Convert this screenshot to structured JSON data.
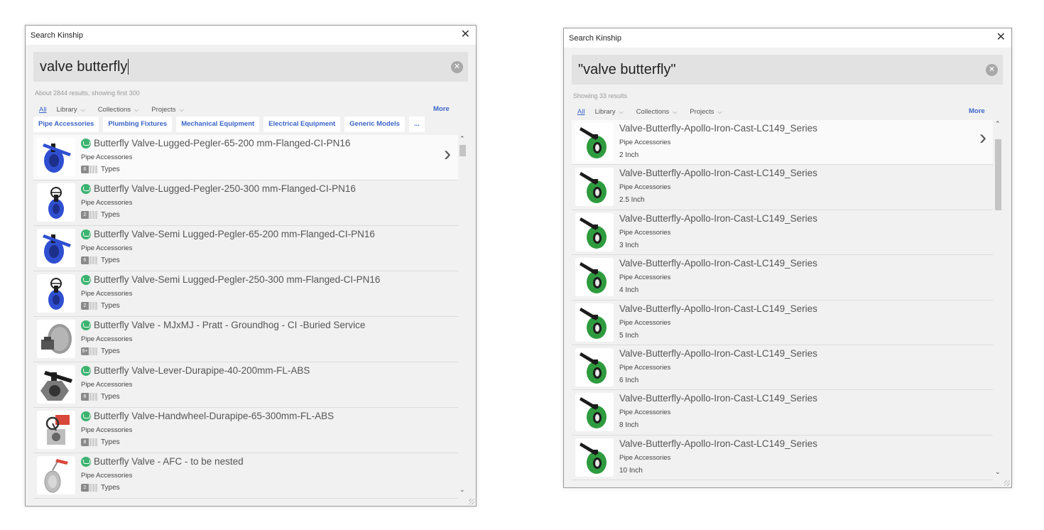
{
  "left_window": {
    "title": "Search Kinship",
    "query": "valve butterfly",
    "result_count": "About 2844 results, showing first 300",
    "tabs": [
      {
        "label": "All"
      },
      {
        "label": "Library"
      },
      {
        "label": "Collections"
      },
      {
        "label": "Projects"
      }
    ],
    "more_label": "More",
    "chips": [
      "Pipe Accessories",
      "Plumbing Fixtures",
      "Mechanical Equipment",
      "Electrical Equipment",
      "Generic Models",
      "..."
    ],
    "results": [
      {
        "title": "Butterfly Valve-Lugged-Pegler-65-200 mm-Flanged-CI-PN16",
        "category": "Pipe Accessories",
        "type_count": "6",
        "types_label": "Types",
        "thumb": "blue-lever-valve"
      },
      {
        "title": "Butterfly Valve-Lugged-Pegler-250-300 mm-Flanged-CI-PN16",
        "category": "Pipe Accessories",
        "type_count": "2",
        "types_label": "Types",
        "thumb": "blue-wheel-valve"
      },
      {
        "title": "Butterfly Valve-Semi Lugged-Pegler-65-200 mm-Flanged-CI-PN16",
        "category": "Pipe Accessories",
        "type_count": "6",
        "types_label": "Types",
        "thumb": "blue-lever-valve"
      },
      {
        "title": "Butterfly Valve-Semi Lugged-Pegler-250-300 mm-Flanged-CI-PN16",
        "category": "Pipe Accessories",
        "type_count": "2",
        "types_label": "Types",
        "thumb": "blue-wheel-valve"
      },
      {
        "title": "Butterfly Valve - MJxMJ - Pratt - Groundhog - CI -Buried Service",
        "category": "Pipe Accessories",
        "type_count": "9+",
        "types_label": "Types",
        "thumb": "grey-buried-valve"
      },
      {
        "title": "Butterfly Valve-Lever-Durapipe-40-200mm-FL-ABS",
        "category": "Pipe Accessories",
        "type_count": "8",
        "types_label": "Types",
        "thumb": "grey-lever-valve"
      },
      {
        "title": "Butterfly Valve-Handwheel-Durapipe-65-300mm-FL-ABS",
        "category": "Pipe Accessories",
        "type_count": "8",
        "types_label": "Types",
        "thumb": "red-wheel-valve"
      },
      {
        "title": "Butterfly Valve - AFC - to be nested",
        "category": "Pipe Accessories",
        "type_count": "2",
        "types_label": "Types",
        "thumb": "red-lever-valve"
      }
    ]
  },
  "right_window": {
    "title": "Search Kinship",
    "query": "\"valve butterfly\"",
    "result_count": "Showing 33 results",
    "tabs": [
      {
        "label": "All"
      },
      {
        "label": "Library"
      },
      {
        "label": "Collections"
      },
      {
        "label": "Projects"
      }
    ],
    "more_label": "More",
    "results": [
      {
        "title": "Valve-Butterfly-Apollo-Iron-Cast-LC149_Series",
        "category": "Pipe Accessories",
        "size": "2 Inch",
        "thumb": "green-valve"
      },
      {
        "title": "Valve-Butterfly-Apollo-Iron-Cast-LC149_Series",
        "category": "Pipe Accessories",
        "size": "2.5 Inch",
        "thumb": "green-valve"
      },
      {
        "title": "Valve-Butterfly-Apollo-Iron-Cast-LC149_Series",
        "category": "Pipe Accessories",
        "size": "3 Inch",
        "thumb": "green-valve"
      },
      {
        "title": "Valve-Butterfly-Apollo-Iron-Cast-LC149_Series",
        "category": "Pipe Accessories",
        "size": "4 Inch",
        "thumb": "green-valve"
      },
      {
        "title": "Valve-Butterfly-Apollo-Iron-Cast-LC149_Series",
        "category": "Pipe Accessories",
        "size": "5 Inch",
        "thumb": "green-valve"
      },
      {
        "title": "Valve-Butterfly-Apollo-Iron-Cast-LC149_Series",
        "category": "Pipe Accessories",
        "size": "6 Inch",
        "thumb": "green-valve"
      },
      {
        "title": "Valve-Butterfly-Apollo-Iron-Cast-LC149_Series",
        "category": "Pipe Accessories",
        "size": "8 Inch",
        "thumb": "green-valve"
      },
      {
        "title": "Valve-Butterfly-Apollo-Iron-Cast-LC149_Series",
        "category": "Pipe Accessories",
        "size": "10 Inch",
        "thumb": "green-valve"
      }
    ]
  },
  "colors": {
    "accent": "#3a63c8",
    "kinship_icon": "#3cb371",
    "valve_blue": "#2f4fd1",
    "valve_green": "#2e9b3e"
  }
}
